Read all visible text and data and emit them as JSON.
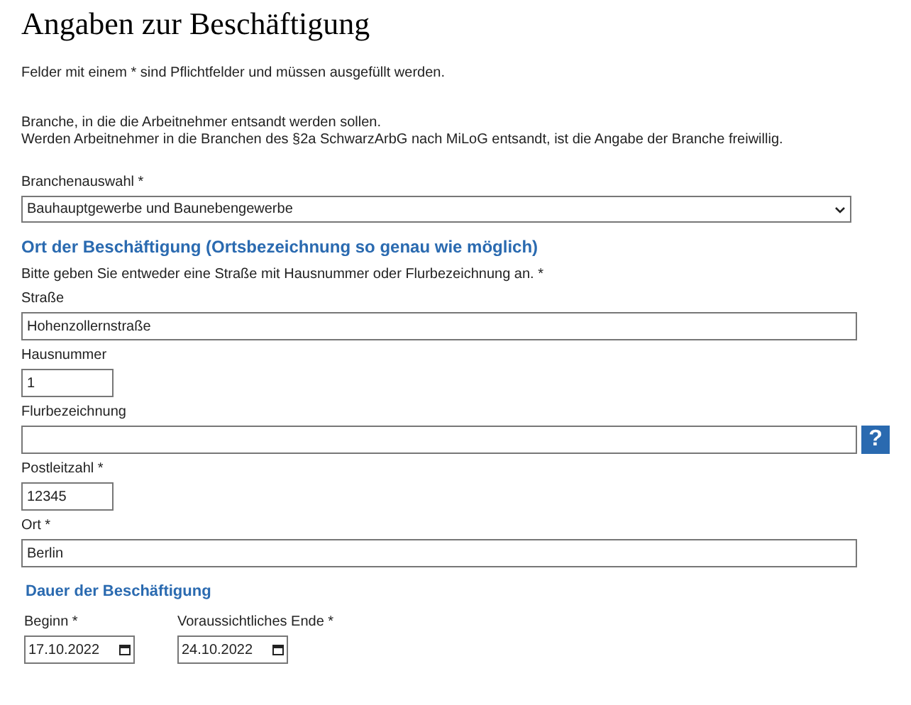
{
  "title": "Angaben zur Beschäftigung",
  "intro": "Felder mit einem * sind Pflichtfelder und müssen ausgefüllt werden.",
  "branch_note": [
    "Branche, in die die Arbeitnehmer entsandt werden sollen.",
    "Werden Arbeitnehmer in die Branchen des §2a SchwarzArbG nach MiLoG entsandt, ist die Angabe der Branche freiwillig."
  ],
  "branch_select": {
    "label": "Branchenauswahl *",
    "value": "Bauhauptgewerbe und Baunebengewerbe"
  },
  "location": {
    "heading": "Ort der Beschäftigung (Ortsbezeichnung so genau wie möglich)",
    "hint": "Bitte geben Sie entweder eine Straße mit Hausnummer oder Flurbezeichnung an. *",
    "fields": [
      {
        "label": "Straße",
        "value": "Hohenzollernstraße",
        "kind": "wide"
      },
      {
        "label": "Hausnummer",
        "value": "1",
        "kind": "short"
      },
      {
        "label": "Flurbezeichnung",
        "kind": "help"
      },
      {
        "label": "Postleitzahl *",
        "value": "12345",
        "kind": "short"
      },
      {
        "label": "Ort *",
        "value": "Berlin",
        "kind": "wide"
      }
    ]
  },
  "help_button": {
    "text": "?"
  },
  "duration": {
    "heading": "Dauer der Beschäftigung",
    "dates": [
      {
        "label": "Beginn *",
        "value": "17.10.2022"
      },
      {
        "label": "Voraussichtliches Ende *",
        "value": "24.10.2022"
      }
    ]
  }
}
